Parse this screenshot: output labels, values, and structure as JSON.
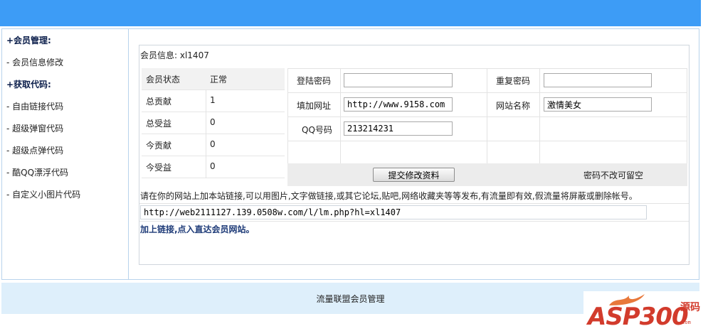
{
  "sidebar": {
    "items": [
      {
        "label": "+会员管理:",
        "type": "head"
      },
      {
        "label": "- 会员信息修改",
        "type": "link"
      },
      {
        "label": "+获取代码:",
        "type": "head"
      },
      {
        "label": "- 自由链接代码",
        "type": "link"
      },
      {
        "label": "- 超级弹窗代码",
        "type": "link"
      },
      {
        "label": "- 超级点弹代码",
        "type": "link"
      },
      {
        "label": "- 酷QQ漂浮代码",
        "type": "link"
      },
      {
        "label": "- 自定义小图片代码",
        "type": "link"
      }
    ]
  },
  "member_info": "会员信息: xl1407",
  "stats": [
    {
      "label": "会员状态",
      "value": "正常"
    },
    {
      "label": "总贡献",
      "value": "1"
    },
    {
      "label": "总受益",
      "value": "0"
    },
    {
      "label": "今贡献",
      "value": "0"
    },
    {
      "label": "今受益",
      "value": "0"
    }
  ],
  "form": {
    "password_label": "登陆密码",
    "password_value": "",
    "repeat_label": "重复密码",
    "repeat_value": "",
    "url_label": "填加网址",
    "url_value": "http://www.9158.com",
    "site_name_label": "网站名称",
    "site_name_value": "激情美女",
    "qq_label": "QQ号码",
    "qq_value": "213214231",
    "submit_label": "提交修改资料",
    "note": "密码不改可留空"
  },
  "description": "请在你的网站上加本站链接,可以用图片,文字做链接,或其它论坛,贴吧,网络收藏夹等等发布,有流量即有效,假流量将屏蔽或删除帐号。",
  "link_url": "http://web2111127.139.0508w.com/l/lm.php?hl=xl1407",
  "add_link_text": "加上链接,点入直达会员网站。",
  "footer": "流量联盟会员管理",
  "watermark": {
    "brand": "ASP300",
    "suffix": "源码",
    "small": ".com"
  },
  "colors": {
    "topbar": "#3d9cf6",
    "footer_bg": "#deeffb",
    "logo": "#d23b2c"
  }
}
